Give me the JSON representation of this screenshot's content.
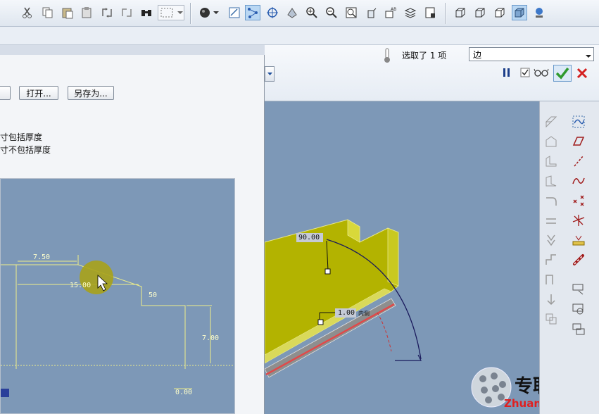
{
  "dashboard": {
    "selection_status": "选取了 1 项",
    "filter_value": "边"
  },
  "dialog": {
    "open_button": "打开...",
    "save_as_button": "另存为...",
    "option_include_thickness": "寸包括厚度",
    "option_exclude_thickness": "寸不包括厚度"
  },
  "preview_dims": {
    "d1": "7.50",
    "d2": "15.00",
    "d3": "50",
    "d4": "7.00",
    "d5": "0.00"
  },
  "model_dims": {
    "angle": "90.00",
    "length": "1.00",
    "length_tag": "内侧"
  },
  "watermark": {
    "cn": "专职网",
    "url": "Zhuanzhi.Net"
  },
  "colors": {
    "viewport_bg": "#7d98b7",
    "part_yellow": "#b3b300",
    "accept_green": "#2e9a2e",
    "cancel_red": "#d42020"
  }
}
